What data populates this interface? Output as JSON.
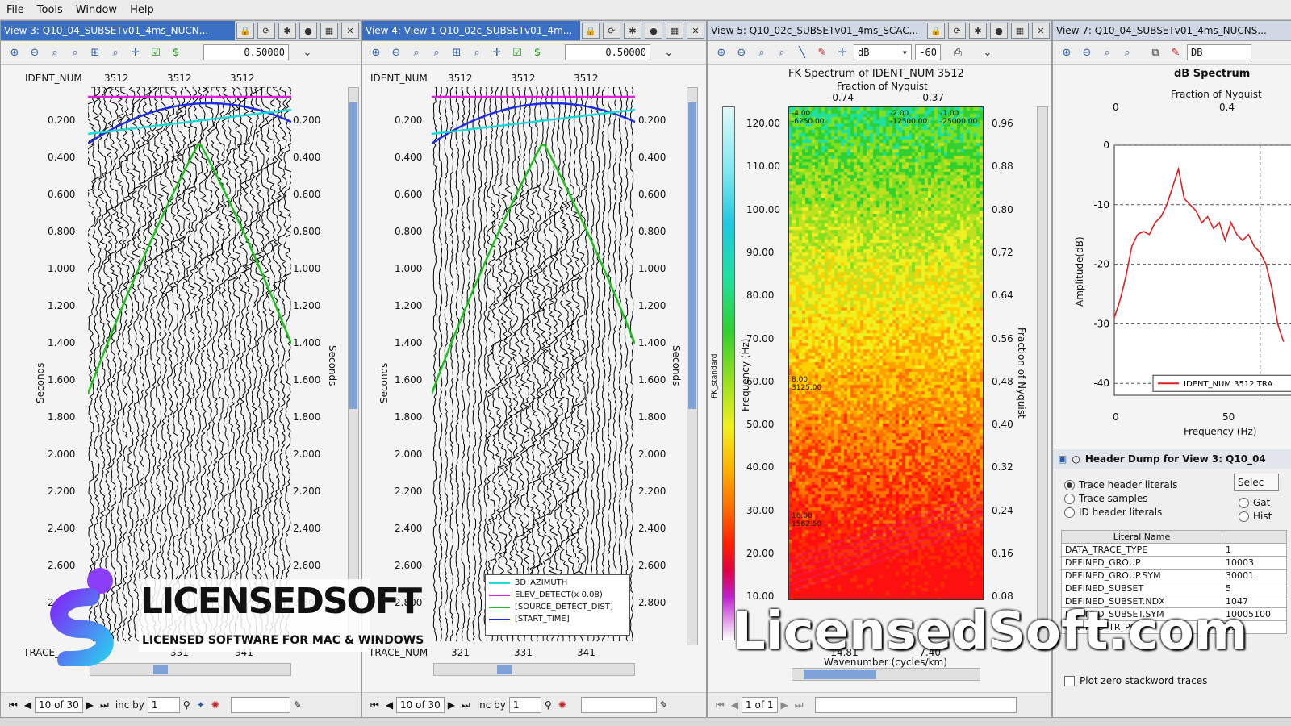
{
  "menu": [
    "File",
    "Tools",
    "Window",
    "Help"
  ],
  "views": [
    {
      "title": "View 3: Q10_04_SUBSETv01_4ms_NUCN...",
      "zoom": "0.50000",
      "header_label": "IDENT_NUM",
      "ident": [
        "3512",
        "3512",
        "3512"
      ],
      "trace_label": "TRACE_",
      "trace_ticks": [
        "331",
        "341"
      ],
      "left_axis": "Seconds",
      "right_axis": "Seconds",
      "page": "10 of 30",
      "inc_label": "inc by",
      "inc": "1"
    },
    {
      "title": "View 4: View 1 Q10_02c_SUBSETv01_4m...",
      "zoom": "0.50000",
      "header_label": "IDENT_NUM",
      "ident": [
        "3512",
        "3512",
        "3512"
      ],
      "trace_label": "TRACE_NUM",
      "trace_ticks": [
        "321",
        "331",
        "341"
      ],
      "left_axis": "Seconds",
      "right_axis": "Seconds",
      "page": "10 of 30",
      "inc_label": "inc by",
      "inc": "1",
      "legend": [
        "3D_AZIMUTH",
        "ELEV_DETECT(x 0.08)",
        "[SOURCE_DETECT_DIST]",
        "[START_TIME]"
      ]
    },
    {
      "title": "View 5: Q10_02c_SUBSETv01_4ms_SCAC...",
      "db": "dB",
      "db_val": "-60",
      "plot_title": "FK Spectrum of IDENT_NUM 3512",
      "top_axis": "Fraction of Nyquist",
      "top_ticks": [
        "-0.74",
        "-0.37"
      ],
      "left_axis": "Frequency (Hz)",
      "right_axis": "Fraction of Nyquist",
      "bottom_axis": "Wavenumber (cycles/km)",
      "bottom_ticks": [
        "-14.81",
        "-7.40"
      ],
      "colorbar_label": "FK_standard",
      "page": "1 of 1",
      "freq_ticks": [
        "120.00",
        "110.00",
        "100.00",
        "90.00",
        "80.00",
        "70.00",
        "60.00",
        "50.00",
        "40.00",
        "30.00",
        "20.00",
        "10.00"
      ],
      "nyq_ticks": [
        "0.96",
        "0.88",
        "0.80",
        "0.72",
        "0.64",
        "0.56",
        "0.48",
        "0.40",
        "0.32",
        "0.24",
        "0.16",
        "0.08"
      ],
      "annotations": [
        "-4.00\n-6250.00",
        "-2.00\n-12500.00",
        "-1.00\n-25000.00",
        "8.00\n3125.00",
        "16.00\n1562.50"
      ]
    },
    {
      "title": "View 7: Q10_04_SUBSETv01_4ms_NUCNS...",
      "db": "DB",
      "plot_title": "dB Spectrum",
      "top_axis": "Fraction of Nyquist",
      "top_ticks": [
        "0",
        "0.4"
      ],
      "y_label": "Amplitude(dB)",
      "x_label": "Frequency (Hz)",
      "x_ticks": [
        "0",
        "50"
      ],
      "legend": "IDENT_NUM 3512 TRA",
      "header_dump_title": "Header Dump for View 3: Q10_04",
      "radios": [
        {
          "label": "Trace header literals",
          "on": true
        },
        {
          "label": "Trace samples",
          "on": false
        },
        {
          "label": "ID header literals",
          "on": false
        }
      ],
      "radios_right": [
        "Gat",
        "Hist"
      ],
      "select_label": "Selec",
      "table_header": "Literal Name",
      "rows": [
        [
          "DATA_TRACE_TYPE",
          "1"
        ],
        [
          "DEFINED_GROUP",
          "10003"
        ],
        [
          "DEFINED_GROUP.SYM",
          "30001"
        ],
        [
          "DEFINED_SUBSET",
          "5"
        ],
        [
          "DEFINED_SUBSET.NDX",
          "1047"
        ],
        [
          "DEFINED_SUBSET.SYM",
          "10005100"
        ],
        [
          "DEFINED_TR_POS",
          "13"
        ]
      ],
      "checkbox": "Plot zero stackword traces"
    }
  ],
  "time_ticks": [
    "0.200",
    "0.400",
    "0.600",
    "0.800",
    "1.000",
    "1.200",
    "1.400",
    "1.600",
    "1.800",
    "2.000",
    "2.200",
    "2.400",
    "2.600",
    "2.800"
  ],
  "chart_data": {
    "type": "line",
    "title": "dB Spectrum",
    "xlabel": "Frequency (Hz)",
    "ylabel": "Amplitude(dB)",
    "ylim": [
      -42,
      0
    ],
    "yticks": [
      0,
      -10,
      -20,
      -30,
      -40
    ],
    "xticks": [
      0,
      50
    ],
    "series": [
      {
        "name": "IDENT_NUM 3512 TRA",
        "x": [
          0,
          2,
          4,
          6,
          8,
          10,
          12,
          14,
          16,
          18,
          20,
          22,
          24,
          26,
          28,
          30,
          32,
          34,
          36,
          38,
          40,
          42,
          44,
          46,
          48,
          50,
          52,
          54,
          56,
          58
        ],
        "y": [
          -29,
          -26,
          -22,
          -17,
          -15,
          -14.5,
          -15,
          -13,
          -12,
          -10,
          -7,
          -4,
          -9,
          -10,
          -11,
          -13,
          -12,
          -14,
          -13,
          -16,
          -13,
          -15,
          -16,
          -15,
          -17,
          -18,
          -20,
          -24,
          -30,
          -33
        ]
      }
    ],
    "color": "#e02020"
  },
  "watermark": {
    "brand": "LICENSEDSOFT",
    "tagline": "LICENSED SOFTWARE FOR MAC & WINDOWS",
    "site": "LicensedSoft.com"
  }
}
